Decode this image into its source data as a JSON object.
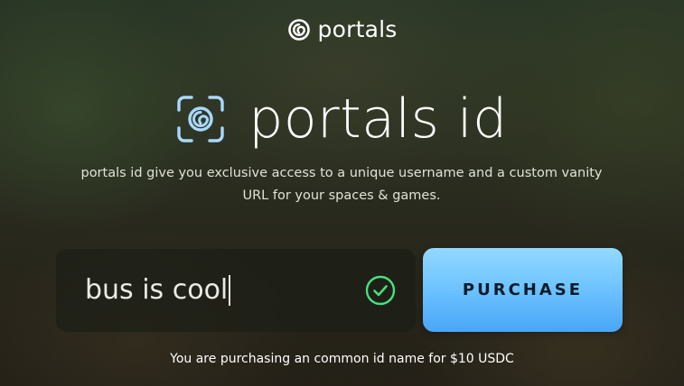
{
  "header": {
    "brand_name": "portals",
    "brand_icon": "portals-swirl-icon"
  },
  "hero": {
    "icon": "portals-id-scan-icon",
    "title": "portals id"
  },
  "description": "portals id give you exclusive access to a unique username and a custom vanity URL for your spaces & games.",
  "id_input": {
    "value": "bus is cool",
    "status_icon": "check-circle-icon",
    "status_color": "#4ade80"
  },
  "purchase_button": {
    "label": "PURCHASE",
    "color": "#6cc2ff"
  },
  "footnote": "You are purchasing an common id name for $10 USDC"
}
